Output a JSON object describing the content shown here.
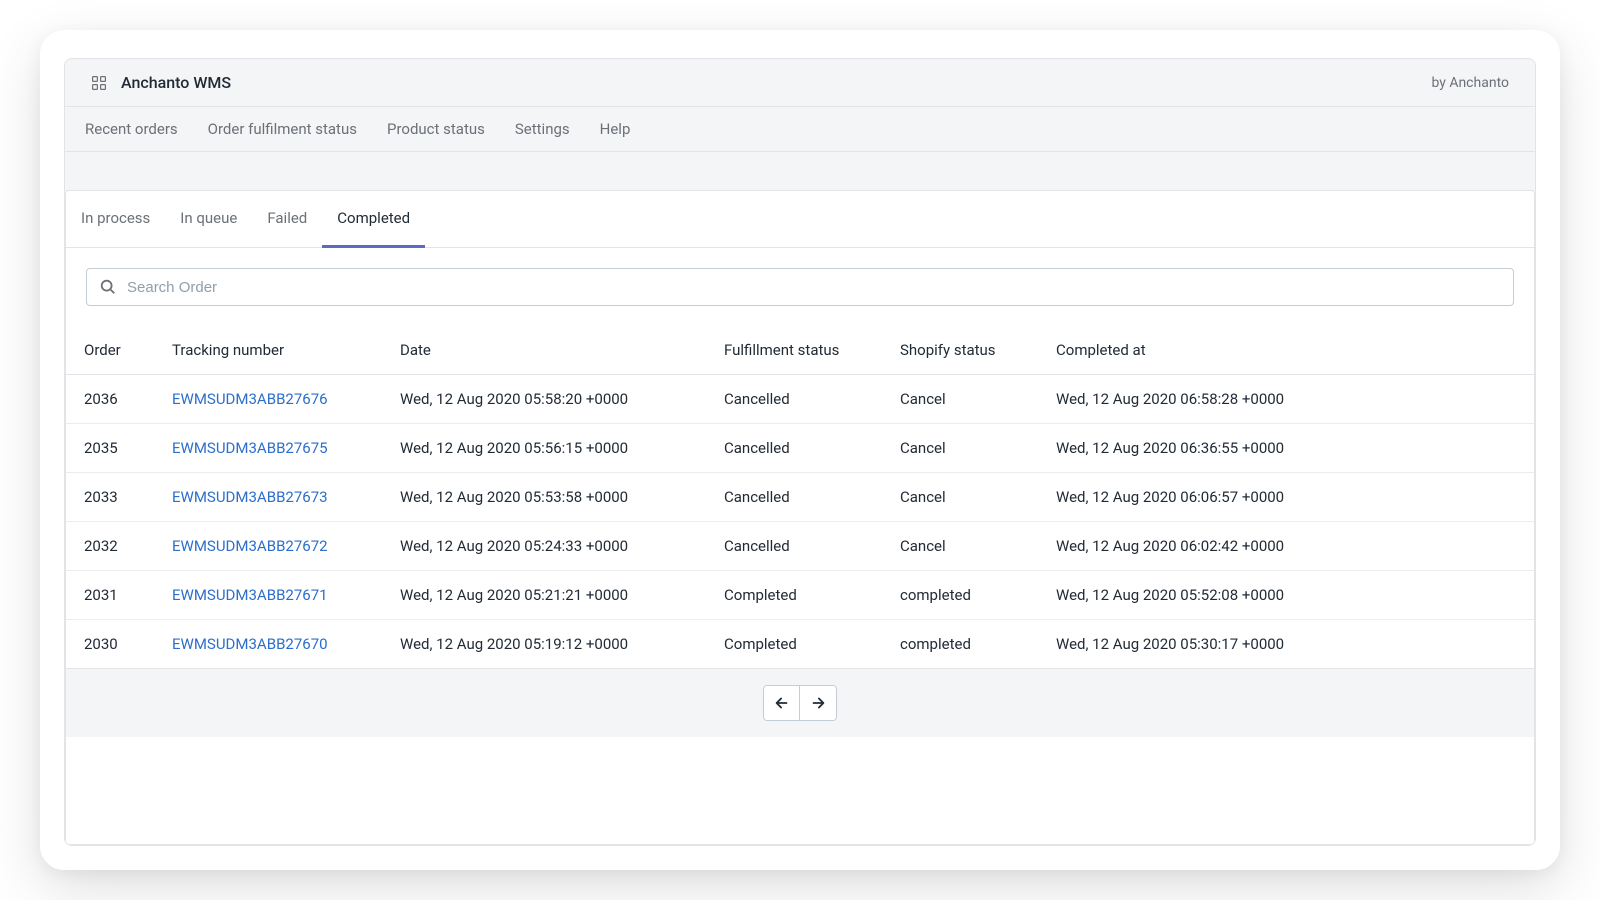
{
  "app": {
    "title": "Anchanto WMS",
    "byline": "by Anchanto"
  },
  "nav": {
    "items": [
      {
        "label": "Recent orders"
      },
      {
        "label": "Order fulfilment status"
      },
      {
        "label": "Product status"
      },
      {
        "label": "Settings"
      },
      {
        "label": "Help"
      }
    ]
  },
  "tabs": {
    "items": [
      {
        "label": "In process",
        "active": false
      },
      {
        "label": "In queue",
        "active": false
      },
      {
        "label": "Failed",
        "active": false
      },
      {
        "label": "Completed",
        "active": true
      }
    ]
  },
  "search": {
    "placeholder": "Search Order"
  },
  "table": {
    "headers": {
      "order": "Order",
      "tracking": "Tracking number",
      "date": "Date",
      "fulfillment": "Fulfillment status",
      "shopify": "Shopify status",
      "completed_at": "Completed at"
    },
    "rows": [
      {
        "order": "2036",
        "tracking": "EWMSUDM3ABB27676",
        "date": "Wed, 12 Aug 2020 05:58:20 +0000",
        "fulfillment": "Cancelled",
        "shopify": "Cancel",
        "completed_at": "Wed, 12 Aug 2020 06:58:28 +0000"
      },
      {
        "order": "2035",
        "tracking": "EWMSUDM3ABB27675",
        "date": "Wed, 12 Aug 2020 05:56:15 +0000",
        "fulfillment": "Cancelled",
        "shopify": "Cancel",
        "completed_at": "Wed, 12 Aug 2020 06:36:55 +0000"
      },
      {
        "order": "2033",
        "tracking": "EWMSUDM3ABB27673",
        "date": "Wed, 12 Aug 2020 05:53:58 +0000",
        "fulfillment": "Cancelled",
        "shopify": "Cancel",
        "completed_at": "Wed, 12 Aug 2020 06:06:57 +0000"
      },
      {
        "order": "2032",
        "tracking": "EWMSUDM3ABB27672",
        "date": "Wed, 12 Aug 2020 05:24:33 +0000",
        "fulfillment": "Cancelled",
        "shopify": "Cancel",
        "completed_at": "Wed, 12 Aug 2020 06:02:42 +0000"
      },
      {
        "order": "2031",
        "tracking": "EWMSUDM3ABB27671",
        "date": "Wed, 12 Aug 2020 05:21:21 +0000",
        "fulfillment": "Completed",
        "shopify": "completed",
        "completed_at": "Wed, 12 Aug 2020 05:52:08 +0000"
      },
      {
        "order": "2030",
        "tracking": "EWMSUDM3ABB27670",
        "date": "Wed, 12 Aug 2020 05:19:12 +0000",
        "fulfillment": "Completed",
        "shopify": "completed",
        "completed_at": "Wed, 12 Aug 2020 05:30:17 +0000"
      }
    ]
  }
}
